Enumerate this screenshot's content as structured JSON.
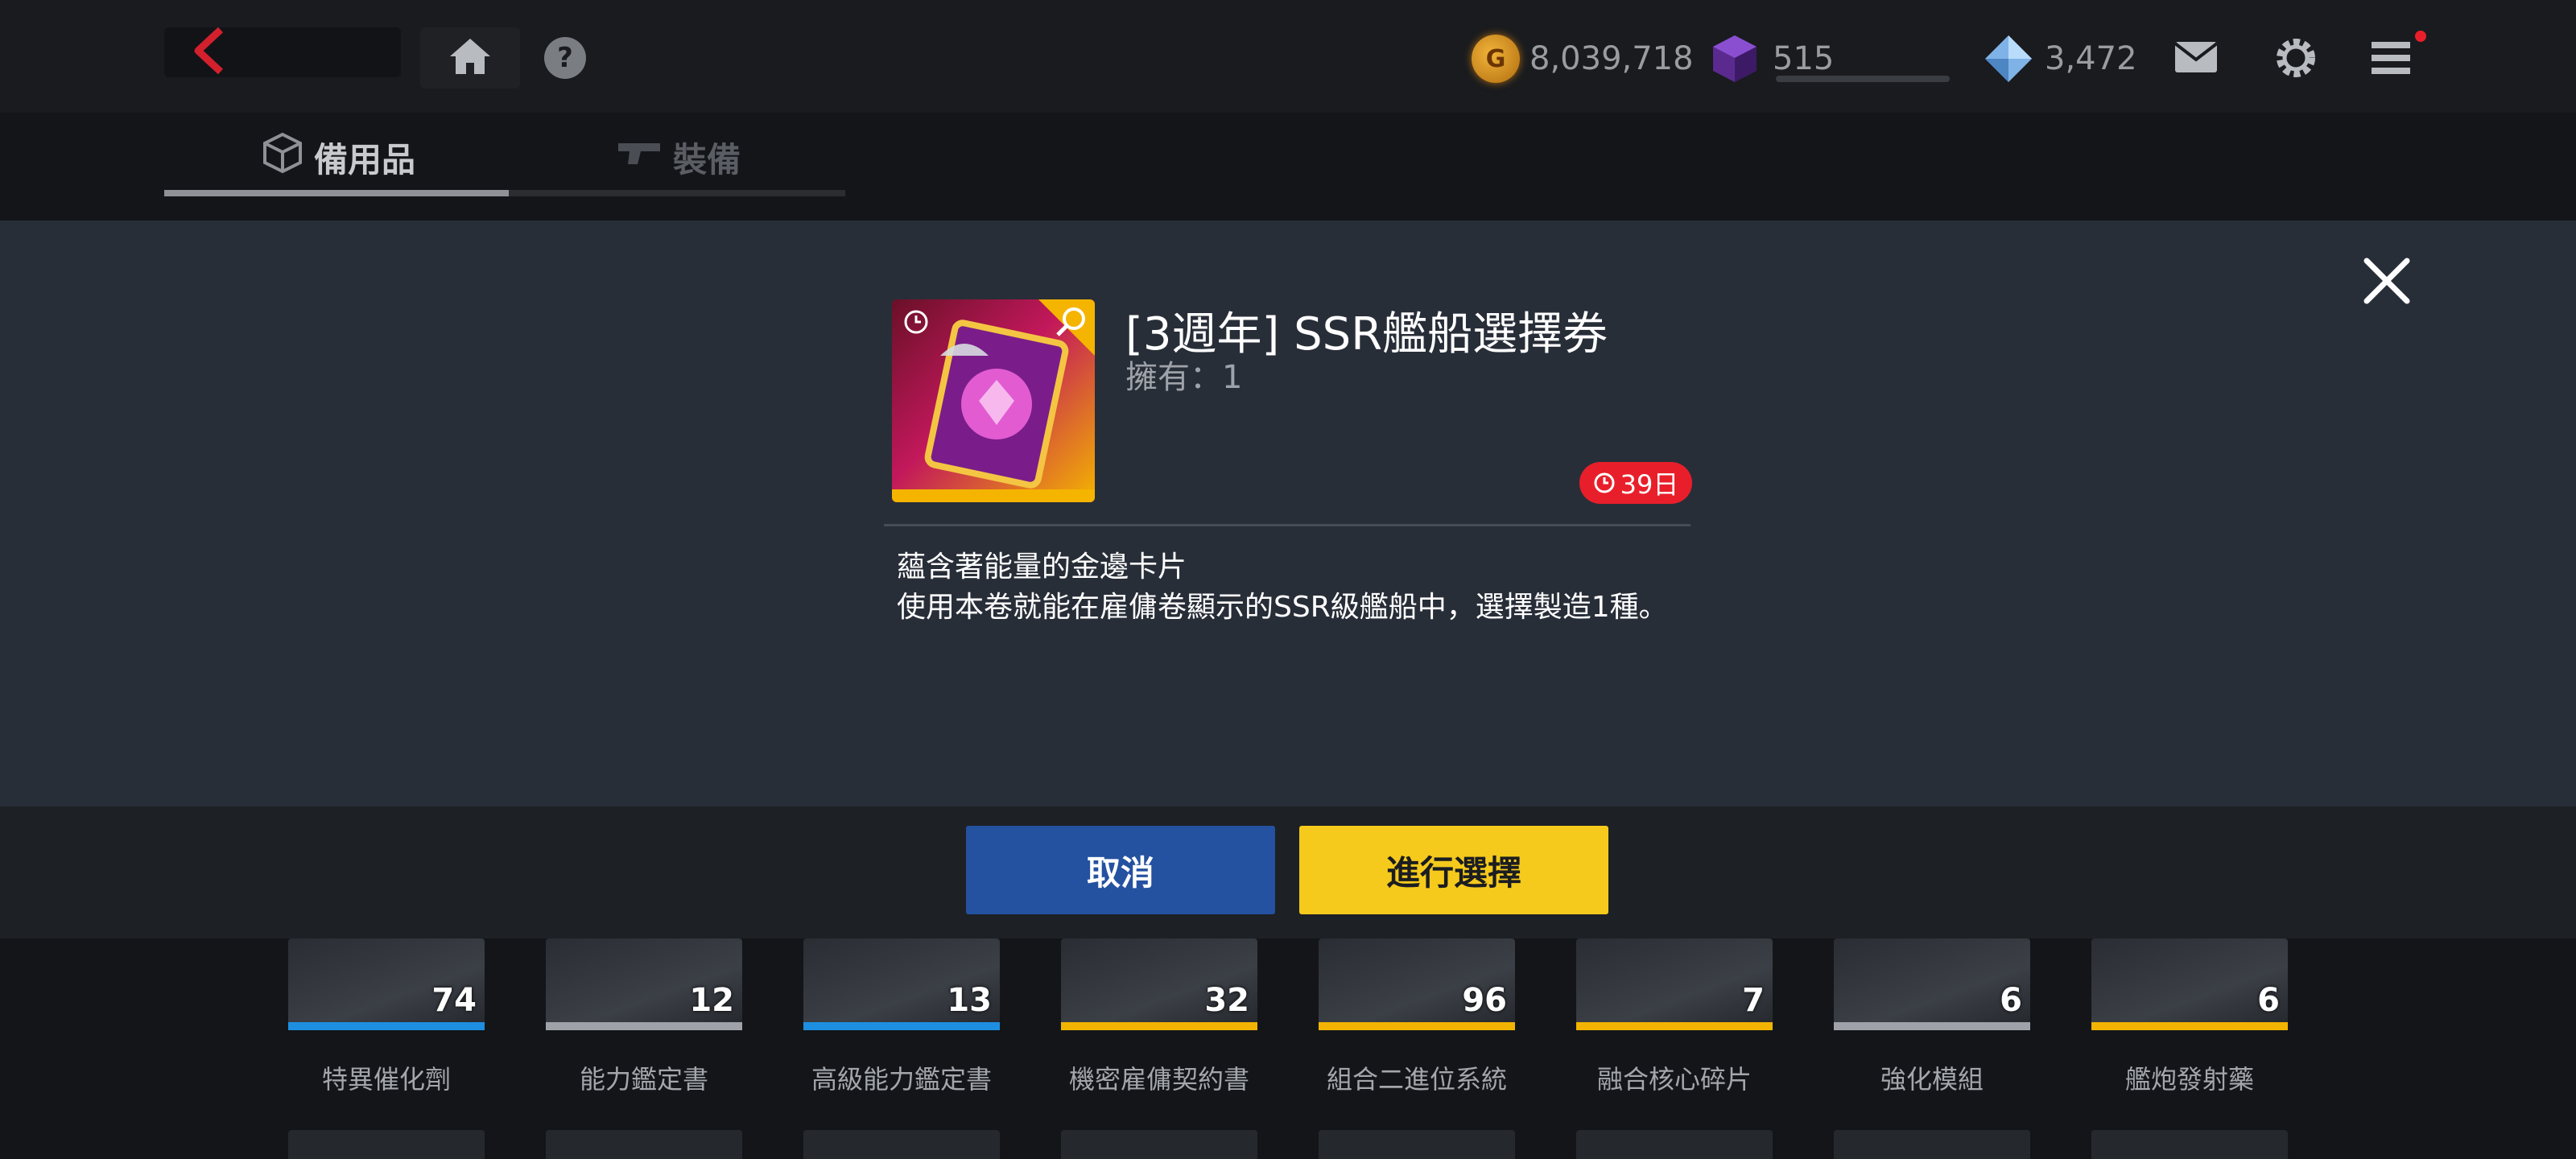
{
  "header": {
    "resources": [
      {
        "icon": "gold-coin-icon",
        "value": "8,039,718"
      },
      {
        "icon": "purple-cube-icon",
        "value": "515",
        "bar_fill": 0
      },
      {
        "icon": "diamond-icon",
        "value": "3,472"
      }
    ],
    "tabs": [
      {
        "label": "備用品",
        "active": true
      },
      {
        "label": "裝備",
        "active": false
      }
    ],
    "menu_notification_color": "#e81f2a"
  },
  "modal": {
    "title": "[3週年] SSR艦船選擇券",
    "owned": "擁有：1",
    "timer": "39日",
    "description": [
      "蘊含著能量的金邊卡片",
      "使用本卷就能在雇傭卷顯示的SSR級艦船中，選擇製造1種。"
    ],
    "cancel_label": "取消",
    "confirm_label": "進行選擇",
    "accent_blue": "#2451a0",
    "accent_yellow": "#f5ca1c"
  },
  "inventory": [
    {
      "label": "特異催化劑",
      "count": "74",
      "color": "#1e8fe0"
    },
    {
      "label": "能力鑑定書",
      "count": "12",
      "color": "#9fa3a9"
    },
    {
      "label": "高級能力鑑定書",
      "count": "13",
      "color": "#1e8fe0"
    },
    {
      "label": "機密雇傭契約書",
      "count": "32",
      "color": "#f2b400"
    },
    {
      "label": "組合二進位系統",
      "count": "96",
      "color": "#f2b400"
    },
    {
      "label": "融合核心碎片",
      "count": "7",
      "color": "#f2b400"
    },
    {
      "label": "強化模組",
      "count": "6",
      "color": "#9fa3a9"
    },
    {
      "label": "艦炮發射藥",
      "count": "6",
      "color": "#f2b400"
    }
  ]
}
